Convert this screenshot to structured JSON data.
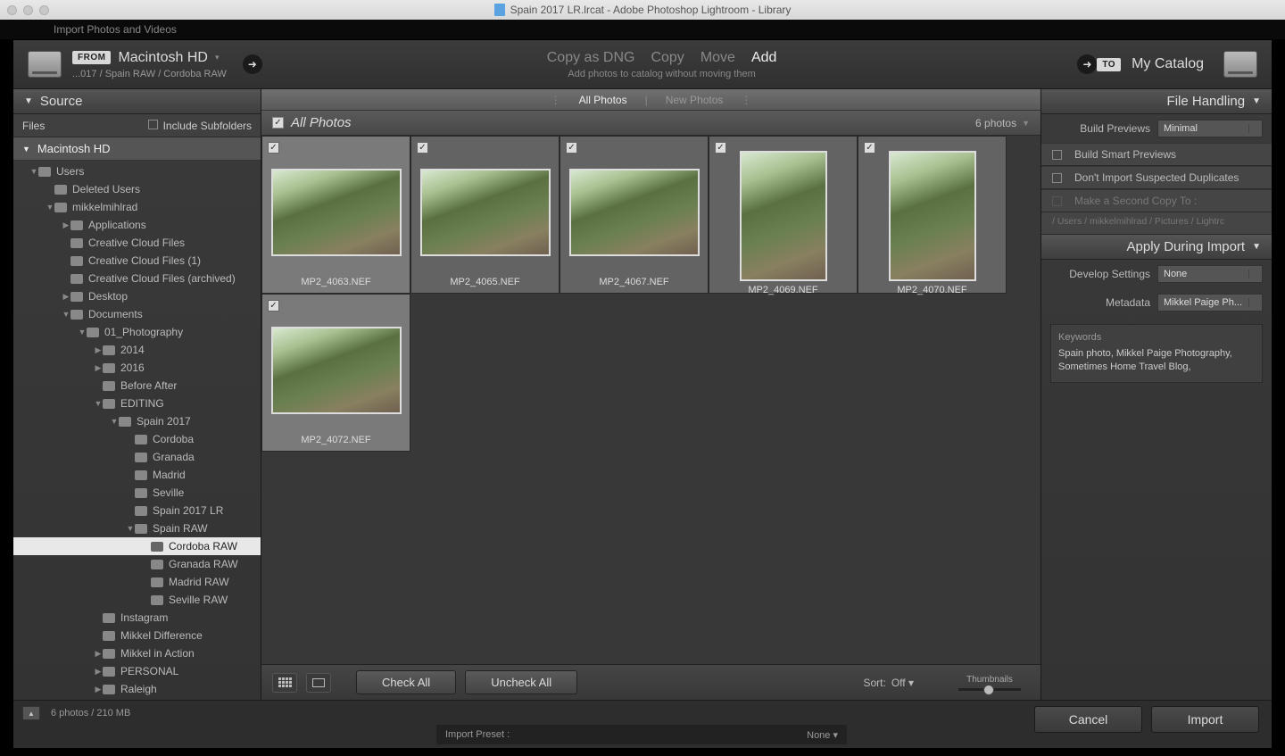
{
  "title": "Spain 2017 LR.lrcat - Adobe Photoshop Lightroom - Library",
  "menubar": "Import Photos and Videos",
  "header": {
    "from_badge": "FROM",
    "from_title": "Macintosh HD",
    "from_path": "...017 / Spain RAW / Cordoba RAW",
    "modes": [
      "Copy as DNG",
      "Copy",
      "Move",
      "Add"
    ],
    "mode_active": 3,
    "mode_sub": "Add photos to catalog without moving them",
    "to_badge": "TO",
    "to_title": "My Catalog"
  },
  "left": {
    "panel": "Source",
    "files": "Files",
    "include": "Include Subfolders",
    "drive": "Macintosh HD",
    "tree": [
      {
        "d": 1,
        "exp": "▼",
        "n": "Users"
      },
      {
        "d": 2,
        "exp": "",
        "n": "Deleted Users"
      },
      {
        "d": 2,
        "exp": "▼",
        "n": "mikkelmihlrad"
      },
      {
        "d": 3,
        "exp": "▶",
        "n": "Applications"
      },
      {
        "d": 3,
        "exp": "",
        "n": "Creative Cloud Files"
      },
      {
        "d": 3,
        "exp": "",
        "n": "Creative Cloud Files (1)"
      },
      {
        "d": 3,
        "exp": "",
        "n": "Creative Cloud Files (archived)"
      },
      {
        "d": 3,
        "exp": "▶",
        "n": "Desktop"
      },
      {
        "d": 3,
        "exp": "▼",
        "n": "Documents"
      },
      {
        "d": 4,
        "exp": "▼",
        "n": "01_Photography"
      },
      {
        "d": 5,
        "exp": "▶",
        "n": "2014"
      },
      {
        "d": 5,
        "exp": "▶",
        "n": "2016"
      },
      {
        "d": 5,
        "exp": "",
        "n": "Before After"
      },
      {
        "d": 5,
        "exp": "▼",
        "n": "EDITING"
      },
      {
        "d": 6,
        "exp": "▼",
        "n": "Spain 2017"
      },
      {
        "d": 7,
        "exp": "",
        "n": "Cordoba"
      },
      {
        "d": 7,
        "exp": "",
        "n": "Granada"
      },
      {
        "d": 7,
        "exp": "",
        "n": "Madrid"
      },
      {
        "d": 7,
        "exp": "",
        "n": "Seville"
      },
      {
        "d": 7,
        "exp": "",
        "n": "Spain 2017 LR"
      },
      {
        "d": 7,
        "exp": "▼",
        "n": "Spain RAW"
      },
      {
        "d": 8,
        "exp": "",
        "n": "Cordoba RAW",
        "sel": true
      },
      {
        "d": 8,
        "exp": "",
        "n": "Granada RAW"
      },
      {
        "d": 8,
        "exp": "",
        "n": "Madrid RAW"
      },
      {
        "d": 8,
        "exp": "",
        "n": "Seville RAW"
      },
      {
        "d": 5,
        "exp": "",
        "n": "Instagram"
      },
      {
        "d": 5,
        "exp": "",
        "n": "Mikkel Difference"
      },
      {
        "d": 5,
        "exp": "▶",
        "n": "Mikkel in Action"
      },
      {
        "d": 5,
        "exp": "▶",
        "n": "PERSONAL"
      },
      {
        "d": 5,
        "exp": "▶",
        "n": "Raleigh"
      }
    ]
  },
  "center": {
    "tab_all": "All Photos",
    "tab_new": "New Photos",
    "heading": "All Photos",
    "count": "6 photos",
    "thumbs": [
      {
        "n": "MP2_4063.NEF",
        "o": "land",
        "sel": true
      },
      {
        "n": "MP2_4065.NEF",
        "o": "land"
      },
      {
        "n": "MP2_4067.NEF",
        "o": "land"
      },
      {
        "n": "MP2_4069.NEF",
        "o": "port"
      },
      {
        "n": "MP2_4070.NEF",
        "o": "port"
      },
      {
        "n": "MP2_4072.NEF",
        "o": "land",
        "sel": true
      }
    ],
    "check_all": "Check All",
    "uncheck_all": "Uncheck All",
    "sort_lbl": "Sort:",
    "sort_val": "Off",
    "thumbs_lbl": "Thumbnails"
  },
  "right": {
    "fh": "File Handling",
    "build_previews_lbl": "Build Previews",
    "build_previews_val": "Minimal",
    "smart": "Build Smart Previews",
    "dup": "Don't Import Suspected Duplicates",
    "copy": "Make a Second Copy To :",
    "copy_path": "/ Users / mikkelmihlrad / Pictures / Lightrc",
    "adi": "Apply During Import",
    "dev_lbl": "Develop Settings",
    "dev_val": "None",
    "meta_lbl": "Metadata",
    "meta_val": "Mikkel Paige Ph...",
    "kw_lbl": "Keywords",
    "kw_txt": "Spain photo, Mikkel Paige Photography, Sometimes Home Travel Blog,"
  },
  "bottom": {
    "status": "6 photos / 210 MB",
    "preset_lbl": "Import Preset :",
    "preset_val": "None",
    "cancel": "Cancel",
    "import": "Import"
  }
}
